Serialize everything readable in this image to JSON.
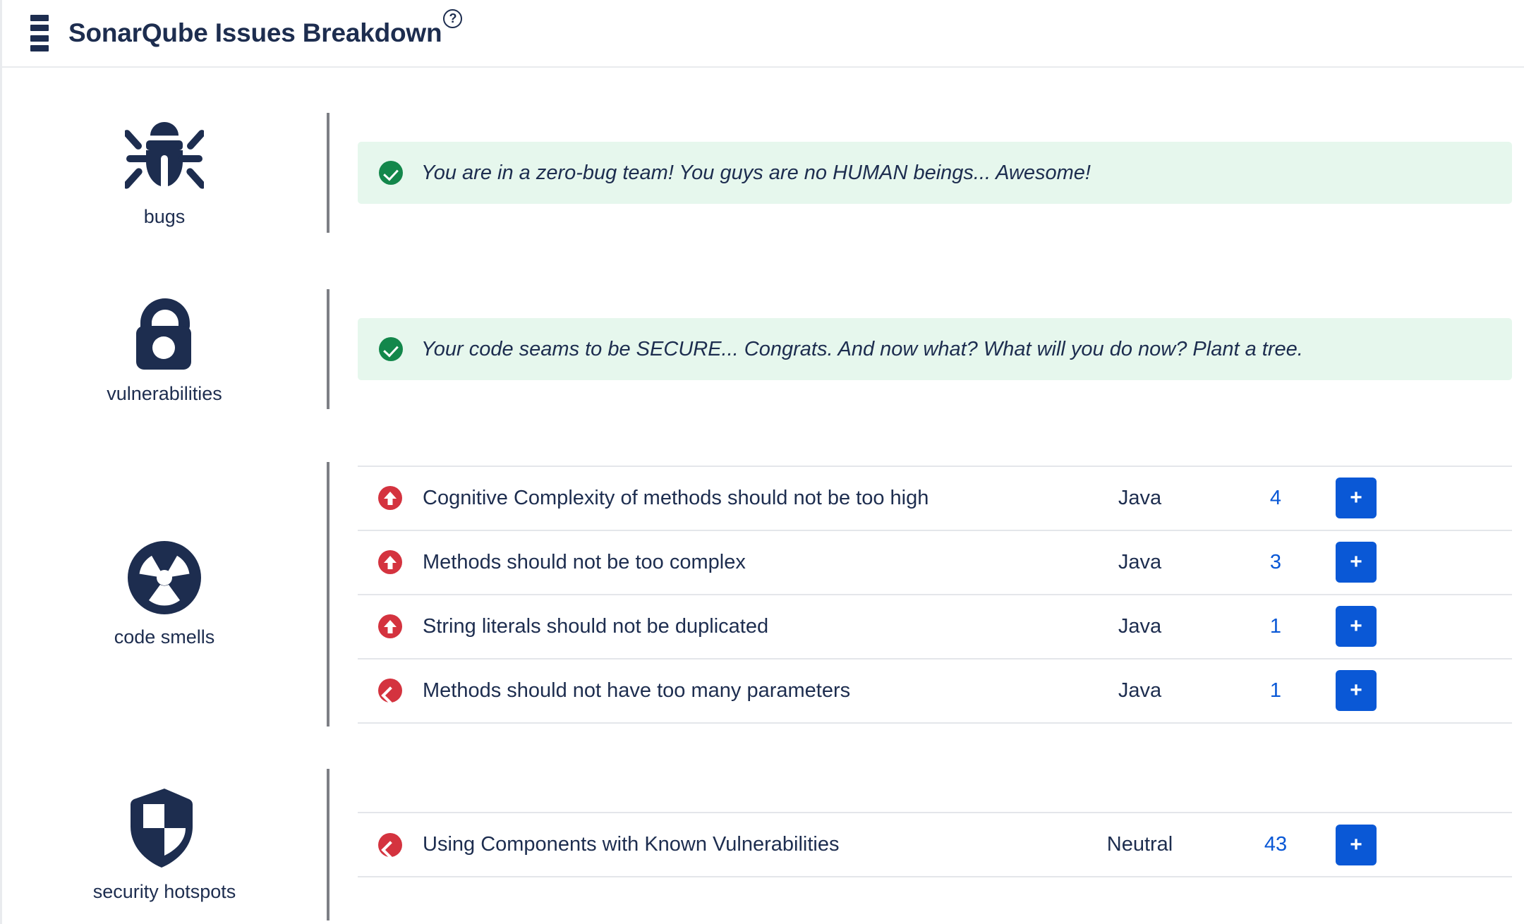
{
  "header": {
    "title": "SonarQube Issues Breakdown",
    "help_glyph": "?",
    "menu_icon": "stacked-bars-icon"
  },
  "colors": {
    "ink": "#1d2d4f",
    "accent_blue": "#0a58d6",
    "success_green": "#13874b",
    "alert_bg": "#e6f7ed",
    "severity_red": "#d4333f",
    "divider": "#7d7f85",
    "row_border": "#e4e6ea"
  },
  "sections": [
    {
      "key": "bugs",
      "label": "bugs",
      "icon": "bug-icon",
      "kind": "alert",
      "alert": {
        "status": "success",
        "icon": "check-circle-icon",
        "message": "You are in a zero-bug team! You guys are no HUMAN beings... Awesome!"
      }
    },
    {
      "key": "vulnerabilities",
      "label": "vulnerabilities",
      "icon": "unlock-icon",
      "kind": "alert",
      "alert": {
        "status": "success",
        "icon": "check-circle-icon",
        "message": "Your code seams to be SECURE... Congrats. And now what? What will you do now? Plant a tree."
      }
    },
    {
      "key": "code_smells",
      "label": "code smells",
      "icon": "radiation-icon",
      "kind": "table",
      "rows": [
        {
          "severity": "blocker",
          "severity_icon": "arrow-up-circle-icon",
          "rule": "Cognitive Complexity of methods should not be too high",
          "language": "Java",
          "count": "4",
          "action_label": "+"
        },
        {
          "severity": "blocker",
          "severity_icon": "arrow-up-circle-icon",
          "rule": "Methods should not be too complex",
          "language": "Java",
          "count": "3",
          "action_label": "+"
        },
        {
          "severity": "blocker",
          "severity_icon": "arrow-up-circle-icon",
          "rule": "String literals should not be duplicated",
          "language": "Java",
          "count": "1",
          "action_label": "+"
        },
        {
          "severity": "critical",
          "severity_icon": "chevron-up-circle-icon",
          "rule": "Methods should not have too many parameters",
          "language": "Java",
          "count": "1",
          "action_label": "+"
        }
      ]
    },
    {
      "key": "security_hotspots",
      "label": "security hotspots",
      "icon": "shield-icon",
      "kind": "table",
      "rows": [
        {
          "severity": "critical",
          "severity_icon": "chevron-up-circle-icon",
          "rule": "Using Components with Known Vulnerabilities",
          "language": "Neutral",
          "count": "43",
          "action_label": "+"
        }
      ]
    }
  ]
}
